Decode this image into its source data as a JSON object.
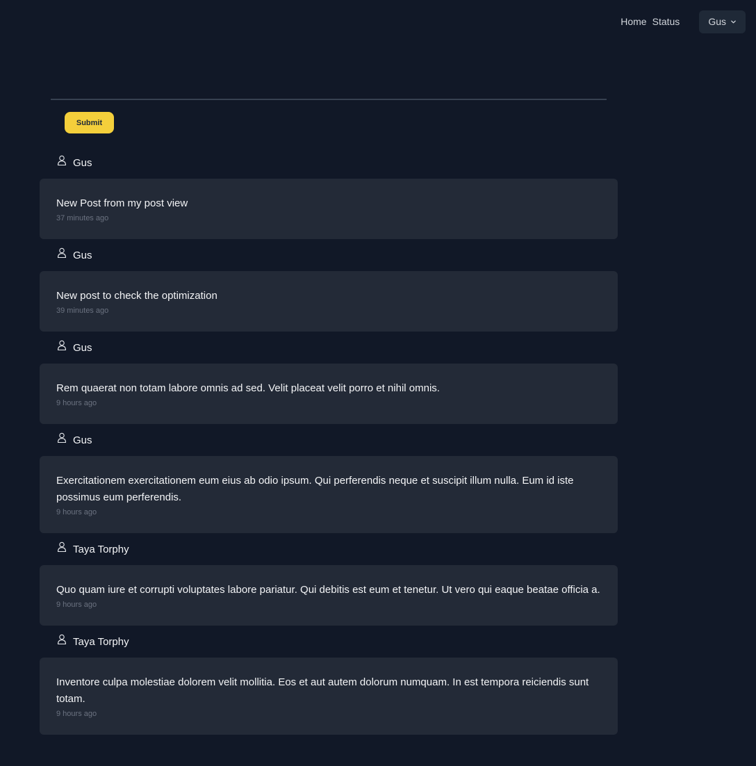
{
  "nav": {
    "links": [
      "Home",
      "Status"
    ],
    "user_menu": "Gus",
    "chevron_icon": "chevron-down-icon"
  },
  "composer": {
    "placeholder": "",
    "submit_label": "Submit"
  },
  "posts": [
    {
      "author": "Gus",
      "body": "New Post from my post view",
      "time": "37 minutes ago"
    },
    {
      "author": "Gus",
      "body": "New post to check the optimization",
      "time": "39 minutes ago"
    },
    {
      "author": "Gus",
      "body": "Rem quaerat non totam labore omnis ad sed. Velit placeat velit porro et nihil omnis.",
      "time": "9 hours ago"
    },
    {
      "author": "Gus",
      "body": "Exercitationem exercitationem eum eius ab odio ipsum. Qui perferendis neque et suscipit illum nulla. Eum id iste possimus eum perferendis.",
      "time": "9 hours ago"
    },
    {
      "author": "Taya Torphy",
      "body": "Quo quam iure et corrupti voluptates labore pariatur. Qui debitis est eum et tenetur. Ut vero qui eaque beatae officia a.",
      "time": "9 hours ago"
    },
    {
      "author": "Taya Torphy",
      "body": "Inventore culpa molestiae dolorem velit mollitia. Eos et aut autem dolorum numquam. In est tempora reiciendis sunt totam.",
      "time": "9 hours ago"
    }
  ],
  "icons": {
    "author": "user-icon"
  },
  "colors": {
    "background": "#111827",
    "card": "#232a37",
    "accent": "#f4cf3b"
  }
}
